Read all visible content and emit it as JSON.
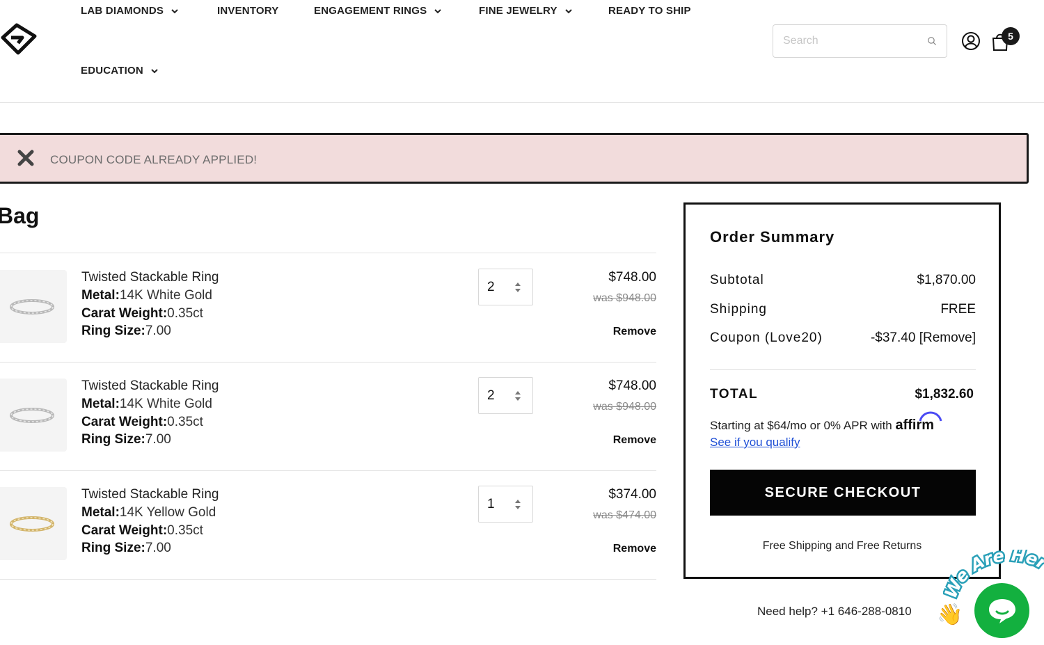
{
  "header": {
    "nav": [
      {
        "label": "LAB DIAMONDS",
        "has_dropdown": true
      },
      {
        "label": "INVENTORY",
        "has_dropdown": false
      },
      {
        "label": "ENGAGEMENT RINGS",
        "has_dropdown": true
      },
      {
        "label": "FINE JEWELRY",
        "has_dropdown": true
      },
      {
        "label": "READY TO SHIP",
        "has_dropdown": false
      },
      {
        "label": "EDUCATION",
        "has_dropdown": true
      }
    ],
    "search_placeholder": "Search",
    "cart_count": "5"
  },
  "alert": {
    "message": "COUPON CODE ALREADY APPLIED!"
  },
  "bag": {
    "title": "Bag",
    "items": [
      {
        "name": "Twisted Stackable Ring",
        "metal_label": "Metal:",
        "metal": "14K White Gold",
        "carat_label": "Carat Weight:",
        "carat": "0.35ct",
        "size_label": "Ring Size:",
        "size": "7.00",
        "qty": "2",
        "price": "$748.00",
        "was": "was $948.00",
        "remove": "Remove",
        "ring_color": "white"
      },
      {
        "name": "Twisted Stackable Ring",
        "metal_label": "Metal:",
        "metal": "14K White Gold",
        "carat_label": "Carat Weight:",
        "carat": "0.35ct",
        "size_label": "Ring Size:",
        "size": "7.00",
        "qty": "2",
        "price": "$748.00",
        "was": "was $948.00",
        "remove": "Remove",
        "ring_color": "white"
      },
      {
        "name": "Twisted Stackable Ring",
        "metal_label": "Metal:",
        "metal": "14K Yellow Gold",
        "carat_label": "Carat Weight:",
        "carat": "0.35ct",
        "size_label": "Ring Size:",
        "size": "7.00",
        "qty": "1",
        "price": "$374.00",
        "was": "was $474.00",
        "remove": "Remove",
        "ring_color": "yellow"
      }
    ]
  },
  "summary": {
    "title": "Order Summary",
    "subtotal_label": "Subtotal",
    "subtotal": "$1,870.00",
    "shipping_label": "Shipping",
    "shipping": "FREE",
    "coupon_label": "Coupon (Love20)",
    "coupon": "-$37.40 [Remove]",
    "total_label": "TOTAL",
    "total": "$1,832.60",
    "affirm_text": "Starting at $64/mo or 0% APR with",
    "affirm_brand": "affirm",
    "qualify_link": "See if you qualify",
    "checkout_label": "SECURE CHECKOUT",
    "free_shipping_note": "Free Shipping and Free Returns"
  },
  "help": {
    "text": "Need help? +1 646-288-0810"
  },
  "chat": {
    "badge_text": "We Are Here"
  },
  "colors": {
    "alert_bg": "#f2dcdc",
    "checkout_bg": "#050505",
    "link": "#1f4fd6",
    "chat_green": "#13b03f"
  }
}
